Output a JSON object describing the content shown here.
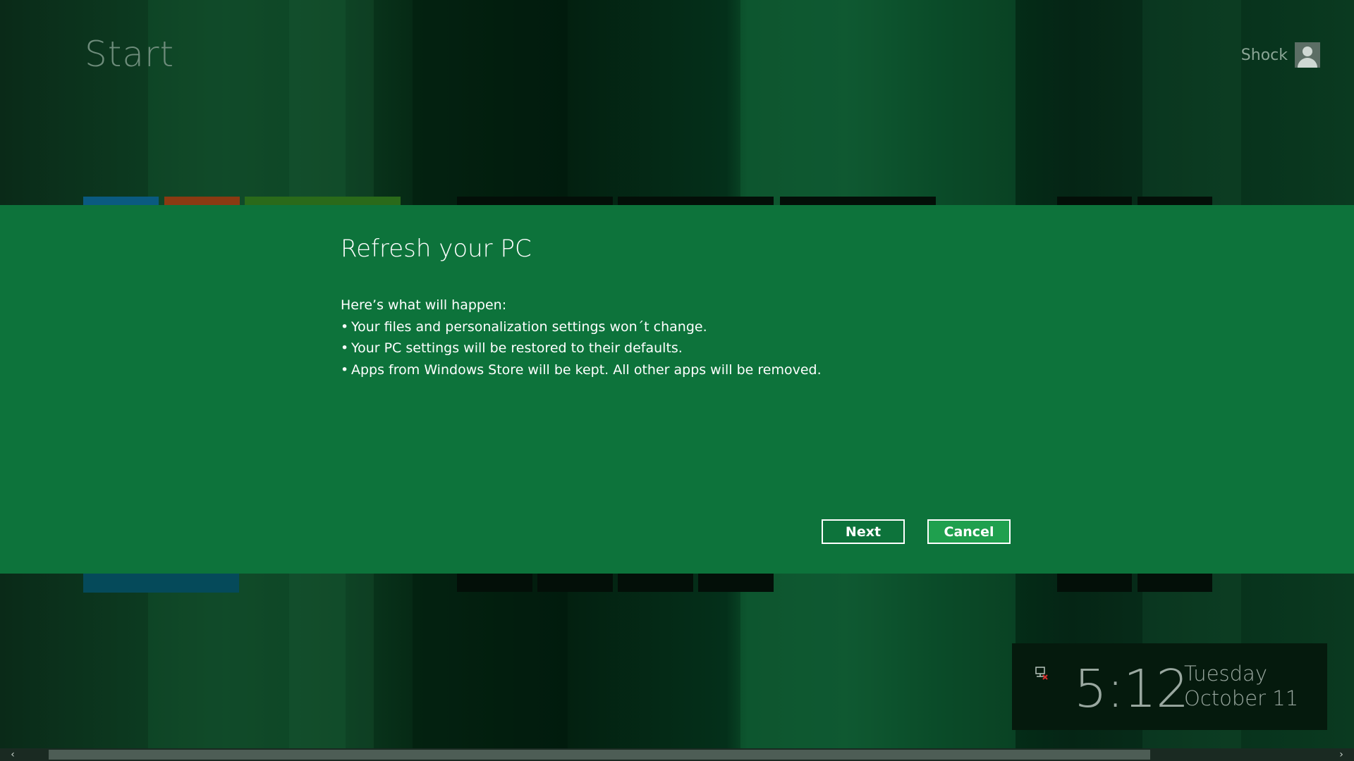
{
  "header": {
    "title": "Start",
    "user_name": "Shock"
  },
  "dialog": {
    "title": "Refresh your PC",
    "intro": "Here’s what will happen:",
    "bullets": [
      "Your files and personalization settings won´t change.",
      "Your PC settings will be restored to their defaults.",
      "Apps from Windows Store will be kept. All other apps will be removed."
    ],
    "next_label": "Next",
    "cancel_label": "Cancel"
  },
  "lock_tile": {
    "time": "5:12",
    "day": "Tuesday",
    "date": "October 11"
  },
  "icons": {
    "user": "user-avatar-icon",
    "network": "network-status-icon",
    "scroll_left": "chevron-left-icon",
    "scroll_right": "chevron-right-icon"
  },
  "colors": {
    "dialog_bg": "#0d733b",
    "cancel_bg": "#1fa04e",
    "tile_blue": "#0a6a8a",
    "tile_orange": "#8a3a12",
    "tile_green": "#2a6a1a"
  }
}
